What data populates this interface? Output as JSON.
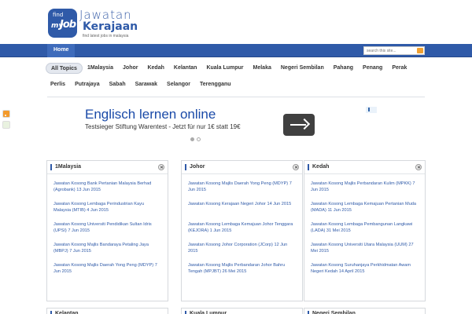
{
  "logo": {
    "badge_find": "find",
    "badge_my": "my",
    "badge_job": "Job",
    "line1": "Jawatan",
    "line2": "Kerajaan",
    "tagline": "find latest jobs in malaysia"
  },
  "nav": {
    "home": "Home",
    "search_placeholder": "search this site..."
  },
  "topics": {
    "row1": [
      "All Topics",
      "1Malaysia",
      "Johor",
      "Kedah",
      "Kelantan",
      "Kuala Lumpur",
      "Melaka",
      "Negeri Sembilan",
      "Pahang",
      "Penang",
      "Perak"
    ],
    "row2": [
      "Perlis",
      "Putrajaya",
      "Sabah",
      "Sarawak",
      "Selangor",
      "Terengganu"
    ]
  },
  "ad": {
    "title": "Englisch lernen online",
    "description": "Testsieger Stiftung Warentest - Jetzt für nur 1€ statt 19€"
  },
  "widgets": [
    {
      "title": "1Malaysia",
      "items": [
        {
          "text": "Jawatan Kosong Bank Pertanian Malaysia Berhad (Agrobank)",
          "date": "13 Jun 2015"
        },
        {
          "text": "Jawatan Kosong Lembaga Perindustrian Kayu Malaysia (MTIB)",
          "date": "4 Jun 2015"
        },
        {
          "text": "Jawatan Kosong Universiti Pendidikan Sultan Idris (UPSI)",
          "date": "7 Jun 2015"
        },
        {
          "text": "Jawatan Kosong Majlis Bandaraya Petaling Jaya (MBPJ)",
          "date": "7 Jun 2015"
        },
        {
          "text": "Jawatan Kosong Majlis Daerah Yong Peng (MDYP)",
          "date": "7 Jun 2015"
        }
      ]
    },
    {
      "title": "Johor",
      "items": [
        {
          "text": "Jawatan Kosong Majlis Daerah Yong Peng (MDYP)",
          "date": "7 Jun 2015"
        },
        {
          "text": "Jawatan Kosong Kerajaan Negeri Johor",
          "date": "14 Jun 2015"
        },
        {
          "text": "Jawatan Kosong Lembaga Kemajuan Johor Tenggara (KEJORA)",
          "date": "1 Jun 2015"
        },
        {
          "text": "Jawatan Kosong Johor Corporation (JCorp)",
          "date": "12 Jun 2015"
        },
        {
          "text": "Jawatan Kosong Majlis Perbandaran Johor Bahru Tengah (MPJBT)",
          "date": "26 Mei 2015"
        }
      ]
    },
    {
      "title": "Kedah",
      "items": [
        {
          "text": "Jawatan Kosong Majlis Perbandaran Kulim (MPKK)",
          "date": "7 Jun 2015"
        },
        {
          "text": "Jawatan Kosong Lembaga Kemajuan Pertanian Muda (MADA)",
          "date": "11 Jun 2015"
        },
        {
          "text": "Jawatan Kosong Lembaga Pembangunan Langkawi (LADA)",
          "date": "31 Mei 2015"
        },
        {
          "text": "Jawatan Kosong Universiti Utara Malaysia (UUM)",
          "date": "27 Mei 2015"
        },
        {
          "text": "Jawatan Kosong Suruhanjaya Perkhidmatan Awam Negeri Kedah",
          "date": "14 April 2015"
        }
      ]
    }
  ],
  "bottom_widgets": [
    "Kelantan",
    "Kuala Lumpur",
    "Negeri Sembilan"
  ]
}
